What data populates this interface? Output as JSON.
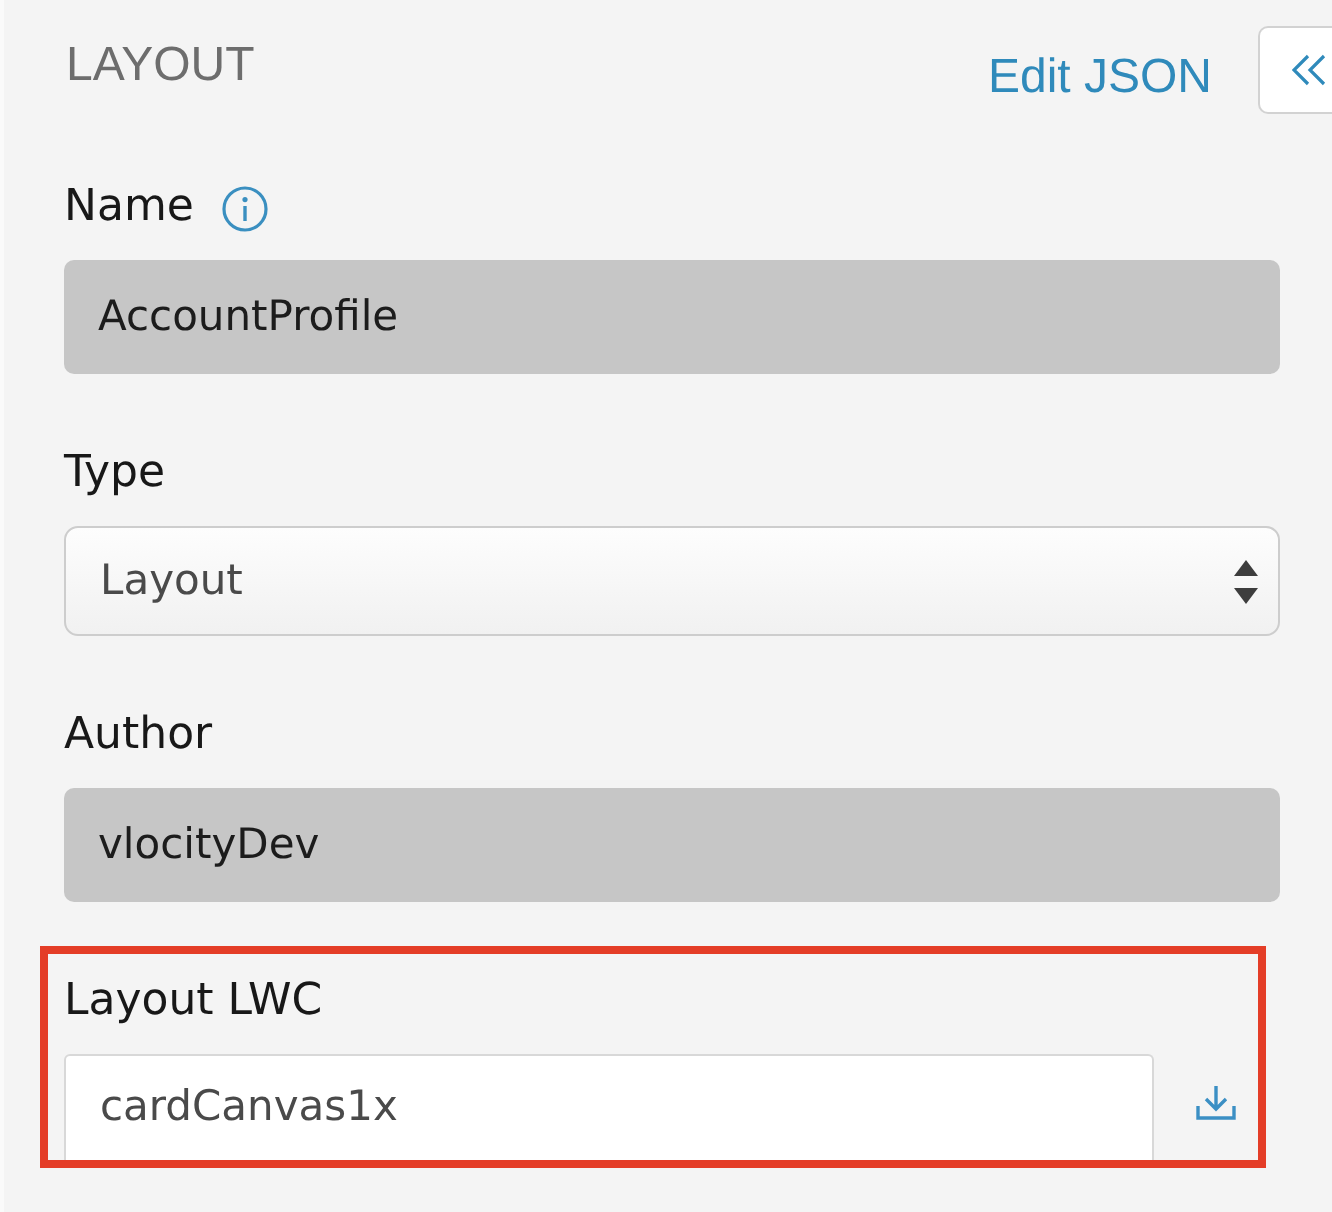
{
  "panel": {
    "title": "LAYOUT",
    "edit_link": "Edit JSON"
  },
  "fields": [
    {
      "kind": "readonly",
      "label": "Name",
      "info": true,
      "value": "AccountProfile"
    },
    {
      "kind": "select",
      "label": "Type",
      "value": "Layout"
    },
    {
      "kind": "readonly",
      "label": "Author",
      "value": "vlocityDev"
    },
    {
      "kind": "input",
      "label": "Layout LWC",
      "value": "cardCanvas1x",
      "highlighted": true,
      "download": true
    }
  ]
}
